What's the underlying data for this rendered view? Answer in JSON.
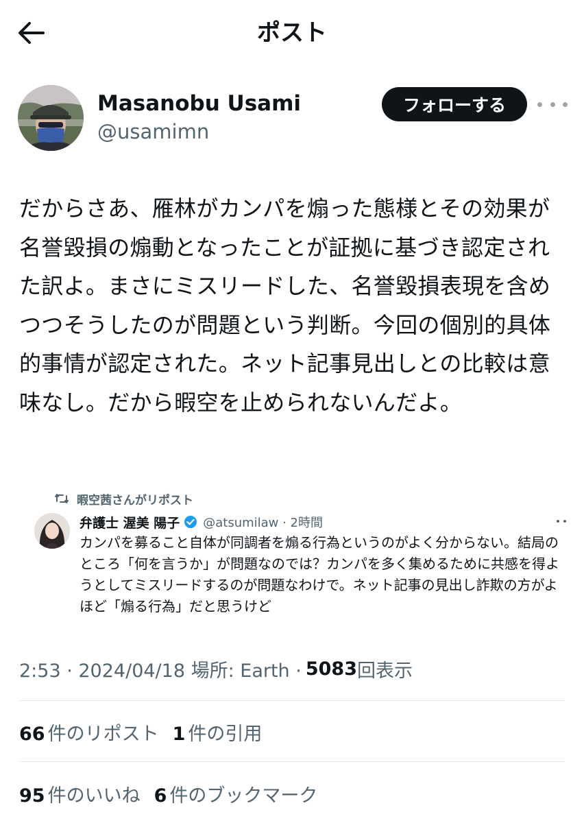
{
  "header": {
    "title": "ポスト",
    "back_icon": "back-arrow-icon"
  },
  "author": {
    "display_name": "Masanobu Usami",
    "handle": "@usamimn",
    "follow_label": "フォローする"
  },
  "post": {
    "text": "だからさあ、雁林がカンパを煽った態様とその効果が名誉毀損の煽動となったことが証拠に基づき認定された訳よ。まさにミスリードした、名誉毀損表現を含めつつそうしたのが問題という判断。今回の個別的具体的事情が認定された。ネット記事見出しとの比較は意味なし。だから暇空を止められないんだよ。"
  },
  "embedded": {
    "repost_label": "暇空茜さんがリポスト",
    "name": "弁護士 渥美 陽子",
    "handle_time": "@atsumilaw · 2時間",
    "text": "カンパを募ること自体が同調者を煽る行為というのがよく分からない。結局のところ「何を言うか」が問題なのでは？カンパを多く集めるために共感を得ようとしてミスリードするのが問題なわけで。ネット記事の見出し詐欺の方がよほど「煽る行為」だと思うけど"
  },
  "meta": {
    "time_date_place": "2:53 · 2024/04/18 場所: Earth ·",
    "views_count": "5083",
    "views_label": "回表示"
  },
  "stats": {
    "reposts_count": "66",
    "reposts_label": "件のリポスト",
    "quotes_count": "1",
    "quotes_label": "件の引用",
    "likes_count": "95",
    "likes_label": "件のいいね",
    "bookmarks_count": "6",
    "bookmarks_label": "件のブックマーク"
  },
  "colors": {
    "text_primary": "#0f1419",
    "text_secondary": "#536471",
    "follow_bg": "#0f1419",
    "verified": "#1d9bf0",
    "divider": "#e3e7ea"
  }
}
